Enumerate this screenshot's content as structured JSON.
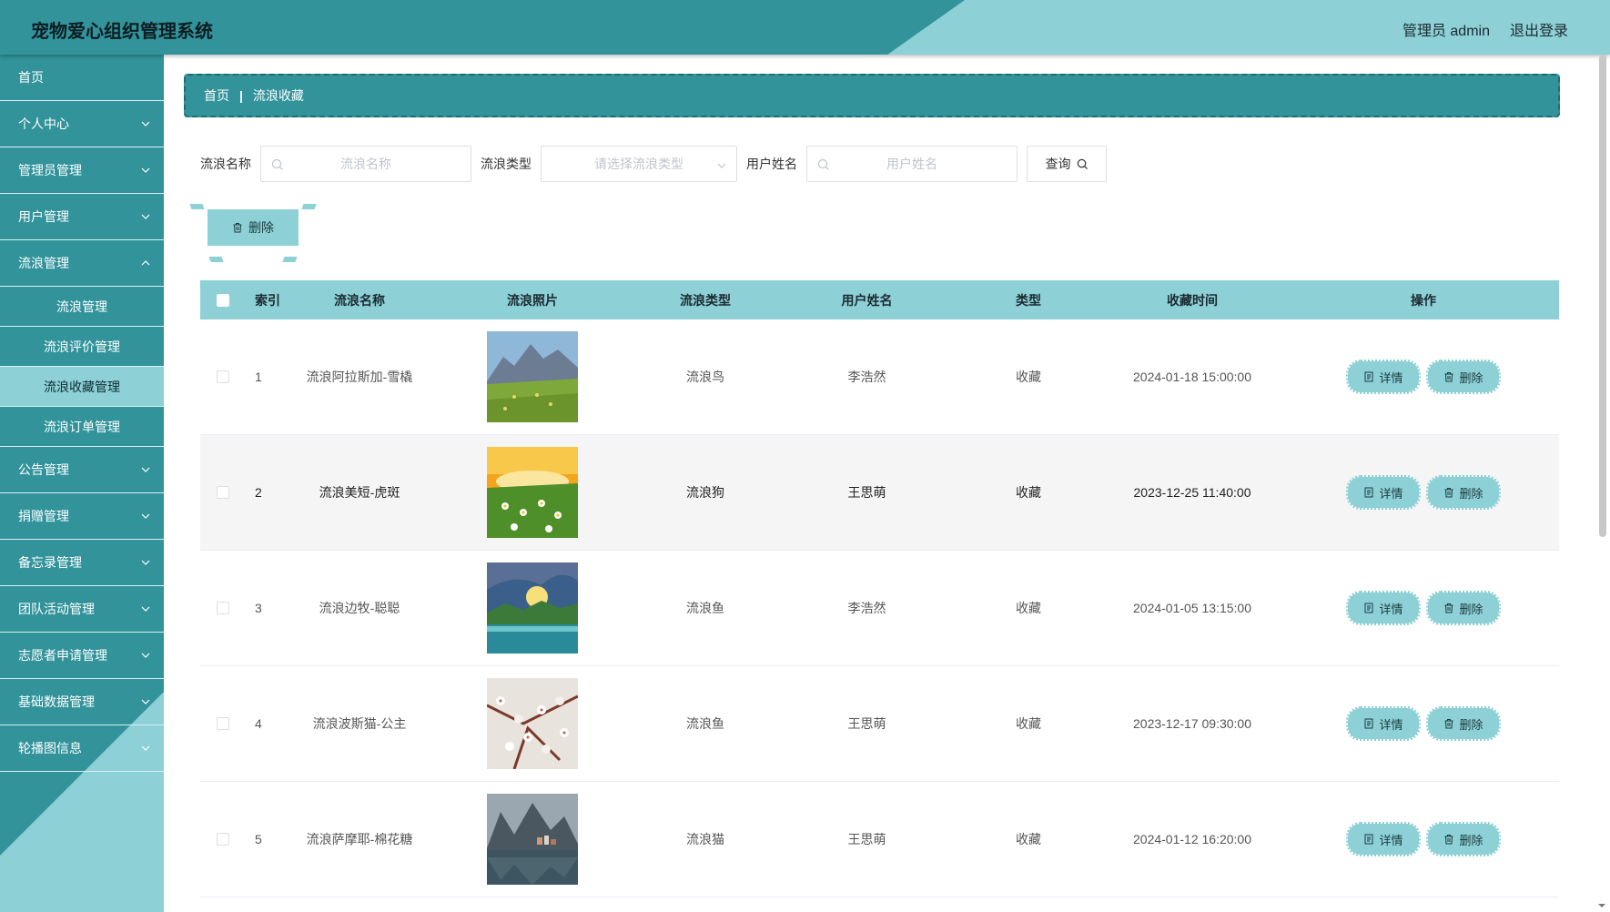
{
  "header": {
    "title": "宠物爱心组织管理系统",
    "user_label": "管理员 admin",
    "logout_label": "退出登录"
  },
  "sidebar": {
    "items": [
      {
        "label": "首页",
        "has_chevron": false
      },
      {
        "label": "个人中心",
        "has_chevron": true
      },
      {
        "label": "管理员管理",
        "has_chevron": true
      },
      {
        "label": "用户管理",
        "has_chevron": true
      },
      {
        "label": "流浪管理",
        "has_chevron": true
      }
    ],
    "sub_items": [
      {
        "label": "流浪管理",
        "active": false
      },
      {
        "label": "流浪评价管理",
        "active": false
      },
      {
        "label": "流浪收藏管理",
        "active": true
      },
      {
        "label": "流浪订单管理",
        "active": false
      }
    ],
    "items_after": [
      {
        "label": "公告管理"
      },
      {
        "label": "捐赠管理"
      },
      {
        "label": "备忘录管理"
      },
      {
        "label": "团队活动管理"
      },
      {
        "label": "志愿者申请管理"
      },
      {
        "label": "基础数据管理"
      },
      {
        "label": "轮播图信息"
      }
    ]
  },
  "breadcrumb": {
    "home": "首页",
    "current": "流浪收藏"
  },
  "search": {
    "name_label": "流浪名称",
    "name_placeholder": "流浪名称",
    "type_label": "流浪类型",
    "type_placeholder": "请选择流浪类型",
    "user_label": "用户姓名",
    "user_placeholder": "用户姓名",
    "query_label": "查询"
  },
  "actions": {
    "bulk_delete_label": "删除"
  },
  "table": {
    "headers": {
      "index": "索引",
      "name": "流浪名称",
      "photo": "流浪照片",
      "type": "流浪类型",
      "user": "用户姓名",
      "kind": "类型",
      "time": "收藏时间",
      "ops": "操作"
    },
    "detail_label": "详情",
    "delete_label": "删除",
    "rows": [
      {
        "index": "1",
        "name": "流浪阿拉斯加-雪橇",
        "type": "流浪鸟",
        "user": "李浩然",
        "kind": "收藏",
        "time": "2024-01-18 15:00:00"
      },
      {
        "index": "2",
        "name": "流浪美短-虎斑",
        "type": "流浪狗",
        "user": "王思萌",
        "kind": "收藏",
        "time": "2023-12-25 11:40:00"
      },
      {
        "index": "3",
        "name": "流浪边牧-聪聪",
        "type": "流浪鱼",
        "user": "李浩然",
        "kind": "收藏",
        "time": "2024-01-05 13:15:00"
      },
      {
        "index": "4",
        "name": "流浪波斯猫-公主",
        "type": "流浪鱼",
        "user": "王思萌",
        "kind": "收藏",
        "time": "2023-12-17 09:30:00"
      },
      {
        "index": "5",
        "name": "流浪萨摩耶-棉花糖",
        "type": "流浪猫",
        "user": "王思萌",
        "kind": "收藏",
        "time": "2024-01-12 16:20:00"
      }
    ]
  },
  "colors": {
    "primary_dark": "#32939b",
    "primary_light": "#8dd0d6"
  }
}
